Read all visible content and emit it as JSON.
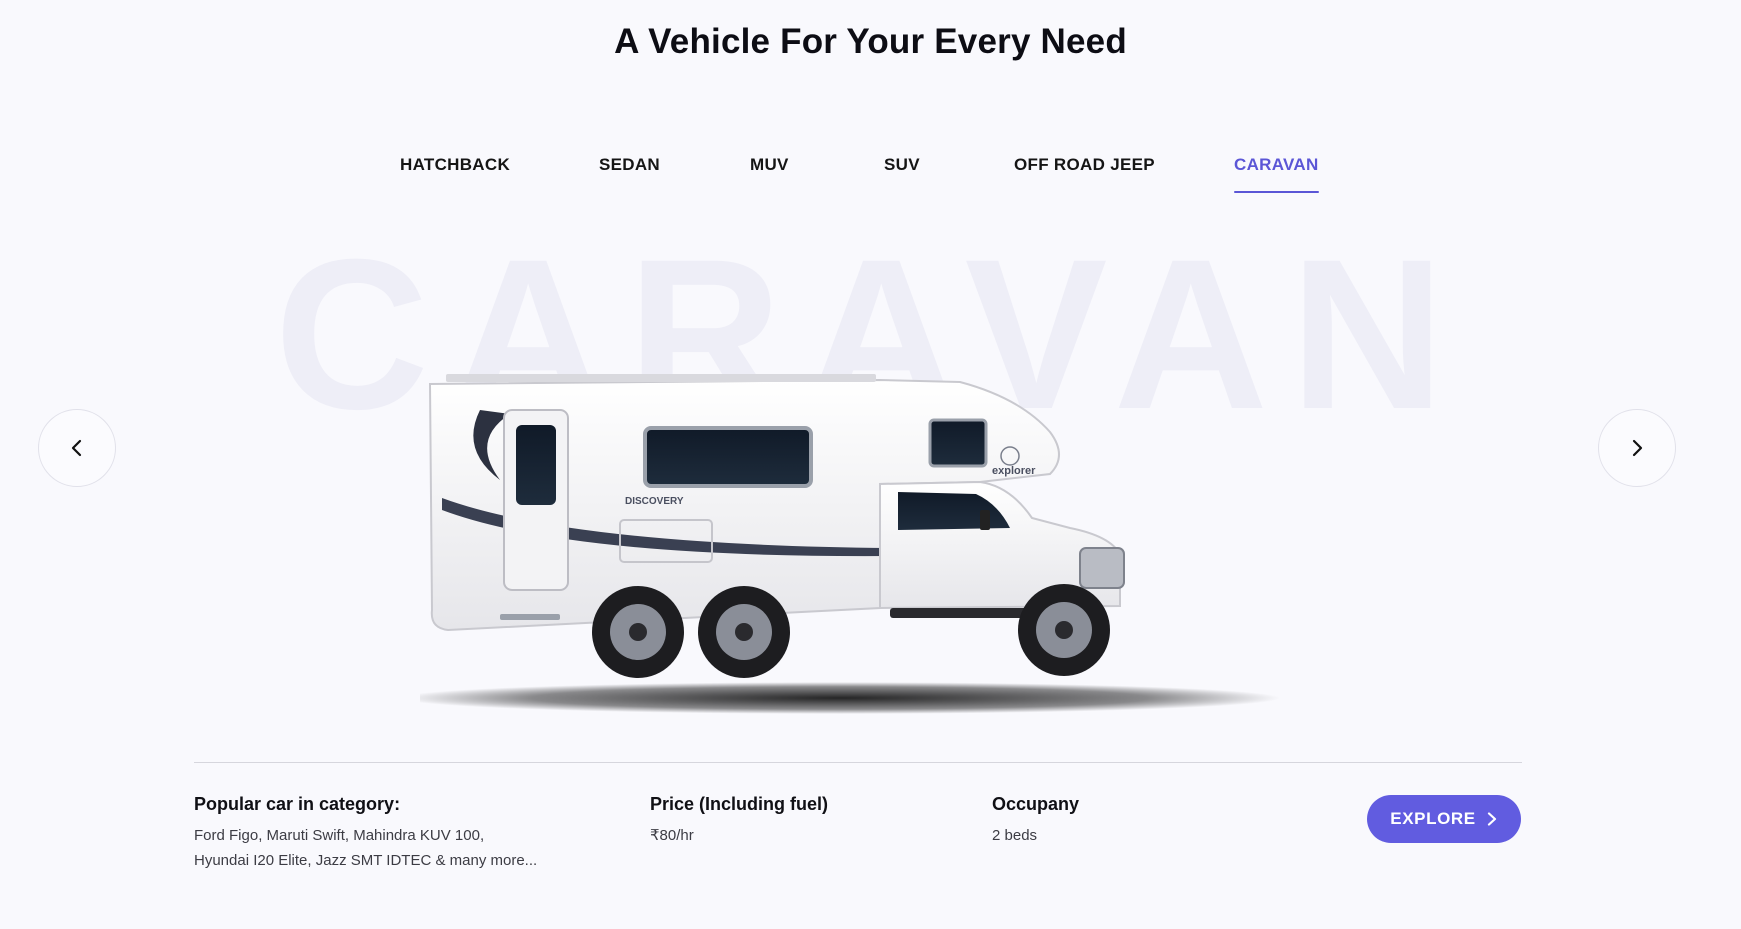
{
  "heading": "A Vehicle For Your Every Need",
  "tabs": [
    {
      "label": "HATCHBACK"
    },
    {
      "label": "SEDAN"
    },
    {
      "label": "MUV"
    },
    {
      "label": "SUV"
    },
    {
      "label": "OFF ROAD JEEP"
    },
    {
      "label": "CARAVAN",
      "active": true
    }
  ],
  "watermark": "CARAVAN",
  "vehicle": {
    "side_text": "DISCOVERY",
    "logo_text": "explorer"
  },
  "navigation": {
    "prev_icon": "chevron-left-icon",
    "next_icon": "chevron-right-icon"
  },
  "details": {
    "popular_label": "Popular car in category:",
    "popular_line1": "Ford Figo, Maruti Swift, Mahindra KUV 100,",
    "popular_line2": "Hyundai I20 Elite, Jazz SMT IDTEC & many more...",
    "price_label": "Price (Including fuel)",
    "price_value": "₹80/hr",
    "occupancy_label": "Occupany",
    "occupancy_value": "2 beds"
  },
  "explore": {
    "label": "EXPLORE",
    "icon": "chevron-right-icon"
  },
  "colors": {
    "accent": "#615ce0",
    "tab_active": "#5b56d6",
    "background": "#f9f9fd"
  }
}
